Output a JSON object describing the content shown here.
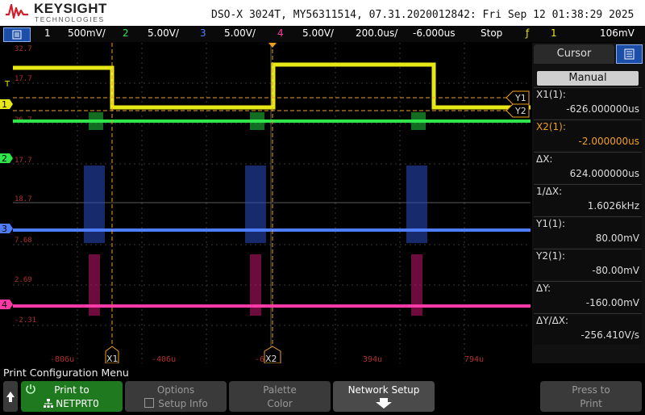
{
  "header": {
    "brand": "KEYSIGHT",
    "brand_sub": "TECHNOLOGIES",
    "instrument": "DSO-X 3024T, MY56311514, 07.31.2020012842: Fri Sep 12 01:38:29 2025"
  },
  "channels": [
    {
      "num": "1",
      "scale": "500mV/",
      "color": "#e8e817"
    },
    {
      "num": "2",
      "scale": "5.00V/",
      "color": "#2ee64b"
    },
    {
      "num": "3",
      "scale": "5.00V/",
      "color": "#4f7dff"
    },
    {
      "num": "4",
      "scale": "5.00V/",
      "color": "#ff3aa6"
    }
  ],
  "timebase": {
    "scale": "200.0us/",
    "delay": "-6.000us"
  },
  "run_state": "Stop",
  "trigger": {
    "channel": "1",
    "level": "106mV"
  },
  "plot": {
    "left_labels": [
      "32.7",
      "17.7",
      "26.7",
      "17.7",
      "18.7",
      "7.68",
      "2.69",
      "-2.31"
    ],
    "x_ticks": [
      "-806u",
      "-406u",
      "-6u",
      "394u",
      "794u"
    ],
    "cursor_x1": "X1",
    "cursor_x2": "X2",
    "cursor_y1": "Y1",
    "cursor_y2": "Y2",
    "ch_markers": [
      "1",
      "2",
      "3",
      "4"
    ]
  },
  "sidebar": {
    "title": "Cursor",
    "mode": "Manual",
    "rows": [
      {
        "label": "X1(1):",
        "value": "-626.000000us",
        "highlight": false
      },
      {
        "label": "X2(1):",
        "value": "-2.000000us",
        "highlight": true
      },
      {
        "label": "ΔX:",
        "value": "624.000000us",
        "highlight": false
      },
      {
        "label": "1/ΔX:",
        "value": "1.6026kHz",
        "highlight": false
      },
      {
        "label": "Y1(1):",
        "value": "80.00mV",
        "highlight": false
      },
      {
        "label": "Y2(1):",
        "value": "-80.00mV",
        "highlight": false
      },
      {
        "label": "ΔY:",
        "value": "-160.00mV",
        "highlight": false
      },
      {
        "label": "ΔY/ΔX:",
        "value": "-256.410V/s",
        "highlight": false
      }
    ]
  },
  "menu": {
    "title": "Print Configuration Menu",
    "softkeys": [
      {
        "line1": "Print to",
        "line2": "NETPRT0"
      },
      {
        "line1": "Options",
        "line2": "Setup Info"
      },
      {
        "line1": "Palette",
        "line2": "Color"
      },
      {
        "line1": "Network Setup",
        "line2": ""
      },
      {
        "line1": "Press to",
        "line2": "Print"
      }
    ]
  }
}
